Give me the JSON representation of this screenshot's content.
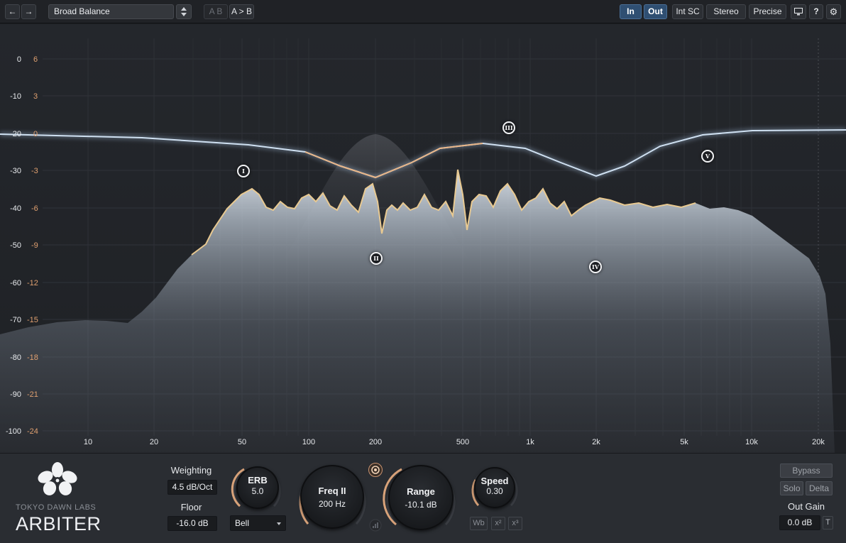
{
  "toolbar": {
    "back_icon": "arrow-left-icon",
    "forward_icon": "arrow-right-icon",
    "preset": "Broad Balance",
    "ab_label": "A B",
    "ab_copy_label": "A > B",
    "in_label": "In",
    "out_label": "Out",
    "int_sc_label": "Int SC",
    "stereo_label": "Stereo",
    "precise_label": "Precise",
    "help_label": "?",
    "monitor_icon": "monitor-icon",
    "settings_icon": "gear-icon"
  },
  "display": {
    "db_left": [
      "0",
      "-10",
      "-20",
      "-30",
      "-40",
      "-50",
      "-60",
      "-70",
      "-80",
      "-90",
      "-100"
    ],
    "db_right": [
      "6",
      "3",
      "0",
      "-3",
      "-6",
      "-9",
      "-12",
      "-15",
      "-18",
      "-21",
      "-24"
    ],
    "freq_labels": [
      "10",
      "20",
      "50",
      "100",
      "200",
      "500",
      "1k",
      "2k",
      "5k",
      "10k",
      "20k"
    ],
    "bands": [
      {
        "label": "I"
      },
      {
        "label": "II"
      },
      {
        "label": "III"
      },
      {
        "label": "IV"
      },
      {
        "label": "V"
      }
    ]
  },
  "controls": {
    "weighting_label": "Weighting",
    "weighting_value": "4.5 dB/Oct",
    "floor_label": "Floor",
    "floor_value": "-16.0 dB",
    "erb_label": "ERB",
    "erb_value": "5.0",
    "shape_value": "Bell",
    "freq_label": "Freq II",
    "freq_value": "200 Hz",
    "range_label": "Range",
    "range_value": "-10.1 dB",
    "speed_label": "Speed",
    "speed_value": "0.30",
    "wb_label": "Wb",
    "x2_label": "x²",
    "x3_label": "x³",
    "bypass_label": "Bypass",
    "solo_label": "Solo",
    "delta_label": "Delta",
    "out_gain_label": "Out Gain",
    "out_gain_value": "0.0 dB",
    "t_label": "T",
    "target_icon": "target-icon",
    "meter_icon": "bar-meter-icon"
  },
  "branding": {
    "brand": "TOKYO DAWN LABS",
    "product": "ARBITER",
    "logo_icon": "flower-logo-icon"
  }
}
